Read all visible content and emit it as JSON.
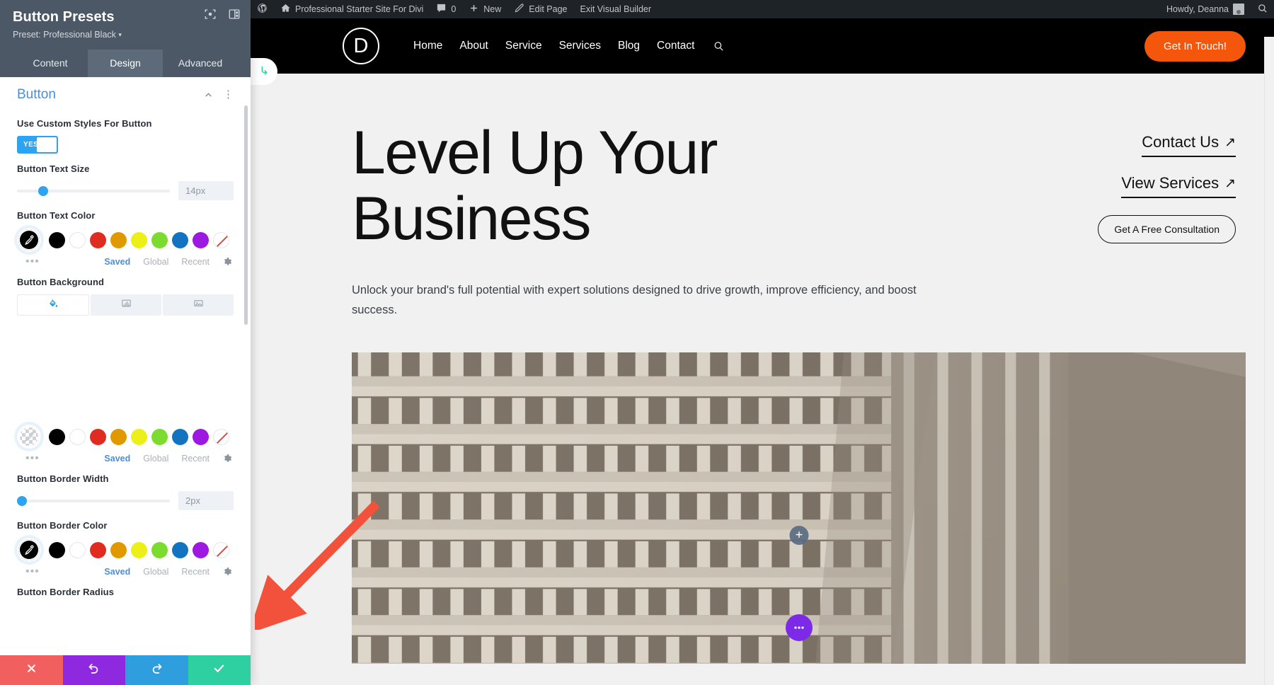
{
  "settings_panel": {
    "title": "Button Presets",
    "preset_label": "Preset: Professional Black",
    "header_icons": [
      {
        "name": "focus-icon"
      },
      {
        "name": "layout-columns-icon"
      }
    ],
    "tabs": [
      {
        "label": "Content",
        "active": false
      },
      {
        "label": "Design",
        "active": true
      },
      {
        "label": "Advanced",
        "active": false
      }
    ],
    "section": {
      "title": "Button",
      "collapse_icon": "chevron-up-icon",
      "menu_icon": "more-vertical-icon"
    },
    "fields": {
      "custom_styles": {
        "label": "Use Custom Styles For Button",
        "toggle_value": "YES"
      },
      "text_size": {
        "label": "Button Text Size",
        "value": "14px",
        "slider_percent": 15
      },
      "text_color": {
        "label": "Button Text Color",
        "selected": "#000000",
        "selected_kind": "pipette",
        "swatches": [
          "#000000",
          "#ffffff",
          "#e02b20",
          "#e09900",
          "#edef18",
          "#7cdb2f",
          "#1273c1",
          "#9d18e0",
          "none"
        ],
        "links": [
          {
            "label": "Saved",
            "active": true
          },
          {
            "label": "Global",
            "active": false
          },
          {
            "label": "Recent",
            "active": false
          }
        ],
        "settings_icon": "gear-icon",
        "more_icon": "more-horizontal-icon"
      },
      "background": {
        "label": "Button Background",
        "types": [
          {
            "name": "solid-color-icon",
            "active": true
          },
          {
            "name": "gradient-icon",
            "active": false
          },
          {
            "name": "image-icon",
            "active": false
          }
        ],
        "selected": "transparent",
        "selected_kind": "checker",
        "swatches": [
          "#000000",
          "#ffffff",
          "#e02b20",
          "#e09900",
          "#edef18",
          "#7cdb2f",
          "#1273c1",
          "#9d18e0",
          "none"
        ],
        "links": [
          {
            "label": "Saved",
            "active": true
          },
          {
            "label": "Global",
            "active": false
          },
          {
            "label": "Recent",
            "active": false
          }
        ]
      },
      "border_width": {
        "label": "Button Border Width",
        "value": "2px",
        "slider_percent": 2
      },
      "border_color": {
        "label": "Button Border Color",
        "selected": "#000000",
        "selected_kind": "pipette",
        "swatches": [
          "#000000",
          "#ffffff",
          "#e02b20",
          "#e09900",
          "#edef18",
          "#7cdb2f",
          "#1273c1",
          "#9d18e0",
          "none"
        ],
        "links": [
          {
            "label": "Saved",
            "active": true
          },
          {
            "label": "Global",
            "active": false
          },
          {
            "label": "Recent",
            "active": false
          }
        ]
      },
      "border_radius": {
        "label": "Button Border Radius"
      }
    },
    "footer_actions": [
      {
        "name": "cancel-button",
        "icon": "close-icon",
        "color": "#f15f5f"
      },
      {
        "name": "undo-button",
        "icon": "undo-icon",
        "color": "#8e29e0"
      },
      {
        "name": "redo-button",
        "icon": "redo-icon",
        "color": "#2e9ede"
      },
      {
        "name": "save-button",
        "icon": "check-icon",
        "color": "#2ecfa0"
      }
    ]
  },
  "admin_bar": {
    "wp_logo": "wordpress-logo-icon",
    "site_name": "Professional Starter Site For Divi",
    "comment_count": "0",
    "new_label": "New",
    "edit_page_label": "Edit Page",
    "exit_builder_label": "Exit Visual Builder",
    "howdy": "Howdy, Deanna",
    "search_icon": "search-icon"
  },
  "site": {
    "logo_letter": "D",
    "nav": [
      {
        "label": "Home"
      },
      {
        "label": "About"
      },
      {
        "label": "Service"
      },
      {
        "label": "Services"
      },
      {
        "label": "Blog"
      },
      {
        "label": "Contact"
      }
    ],
    "nav_search_icon": "search-icon",
    "cta_label": "Get In Touch!",
    "left_tab_icon": "return-arrow-icon",
    "hero": {
      "title_line1": "Level Up Your",
      "title_line2": "Business",
      "subtitle": "Unlock your brand's full potential with expert solutions designed to drive growth, improve efficiency, and boost success.",
      "links": [
        {
          "label": "Contact Us",
          "arrow": "↗"
        },
        {
          "label": "View Services",
          "arrow": "↗"
        }
      ],
      "button_label": "Get A Free Consultation"
    },
    "image_overlay": {
      "add_module_icon": "plus-icon",
      "more_options_icon": "more-horizontal-icon"
    }
  },
  "annotation": {
    "arrow_color": "#f2523c"
  }
}
